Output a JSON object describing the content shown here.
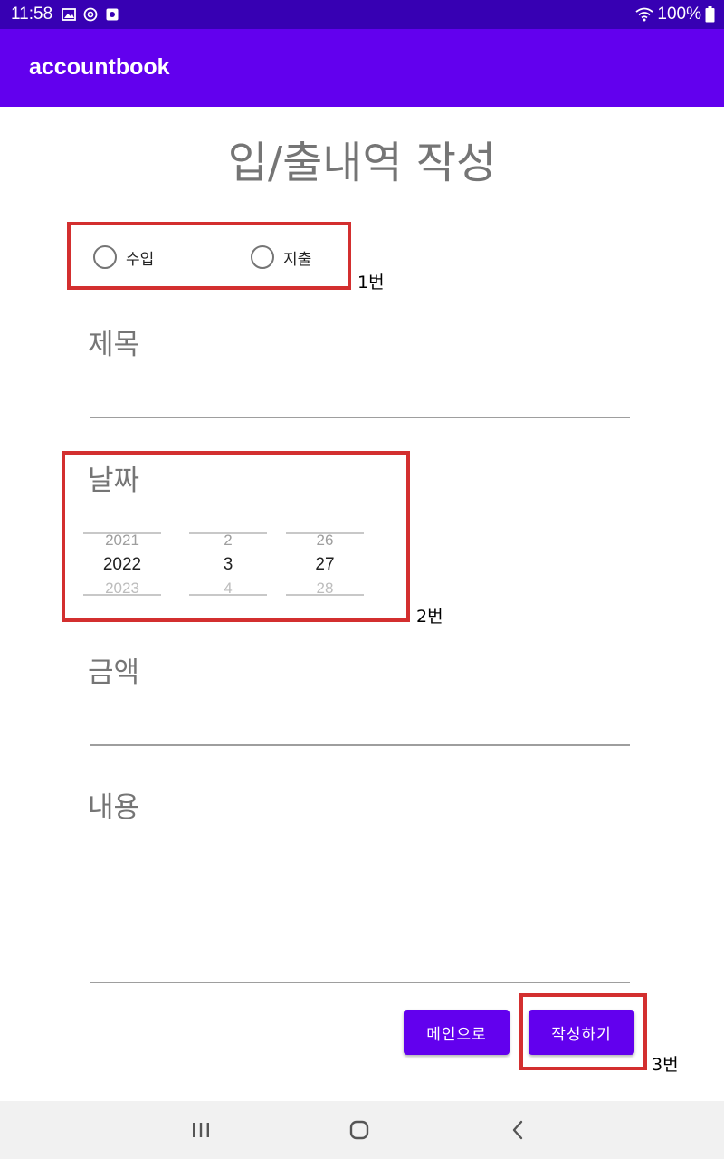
{
  "status_bar": {
    "time": "11:58",
    "battery": "100%",
    "icons": [
      "image-icon",
      "sync-icon",
      "app-icon",
      "wifi-icon",
      "battery-icon"
    ]
  },
  "app_bar": {
    "title": "accountbook",
    "color": "#6200ee"
  },
  "form": {
    "title": "입/출내역 작성",
    "type_options": [
      {
        "label": "수입",
        "selected": false
      },
      {
        "label": "지출",
        "selected": false
      }
    ],
    "title_field": {
      "label": "제목",
      "value": ""
    },
    "date_field": {
      "label": "날짜",
      "year": {
        "prev": "2021",
        "current": "2022",
        "next": "2023"
      },
      "month": {
        "prev": "2",
        "current": "3",
        "next": "4"
      },
      "day": {
        "prev": "26",
        "current": "27",
        "next": "28"
      }
    },
    "amount_field": {
      "label": "금액",
      "value": ""
    },
    "content_field": {
      "label": "내용",
      "value": ""
    }
  },
  "buttons": {
    "main": "메인으로",
    "submit": "작성하기"
  },
  "annotations": {
    "a1": "1번",
    "a2": "2번",
    "a3": "3번"
  },
  "nav_bar": {
    "icons": [
      "recent-apps-icon",
      "home-icon",
      "back-icon"
    ]
  }
}
